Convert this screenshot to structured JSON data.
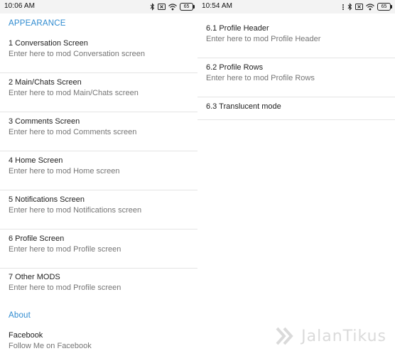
{
  "left": {
    "status": {
      "time": "10:06 AM",
      "battery": "65"
    },
    "appearance_header": "APPEARANCE",
    "items": [
      {
        "title": "1 Conversation Screen",
        "subtitle": "Enter here to mod Conversation screen"
      },
      {
        "title": "2 Main/Chats Screen",
        "subtitle": "Enter here to mod Main/Chats screen"
      },
      {
        "title": "3 Comments Screen",
        "subtitle": "Enter here to mod Comments screen"
      },
      {
        "title": "4 Home Screen",
        "subtitle": "Enter here to mod Home screen"
      },
      {
        "title": "5 Notifications Screen",
        "subtitle": "Enter here to mod Notifications screen"
      },
      {
        "title": "6 Profile Screen",
        "subtitle": "Enter here to mod Profile screen"
      },
      {
        "title": "7 Other MODS",
        "subtitle": "Enter here to mod Profile screen"
      }
    ],
    "about_header": "About",
    "about_items": [
      {
        "title": "Facebook",
        "subtitle": "Follow Me on Facebook"
      }
    ]
  },
  "right": {
    "status": {
      "time": "10:54 AM",
      "battery": "65"
    },
    "items": [
      {
        "title": "6.1 Profile Header",
        "subtitle": "Enter here to mod Profile Header"
      },
      {
        "title": "6.2 Profile Rows",
        "subtitle": "Enter here to mod Profile Rows"
      },
      {
        "title": "6.3 Translucent mode"
      }
    ]
  },
  "watermark": {
    "text": "JalanTikus",
    "icon": "jalantikus-logo-icon"
  },
  "colors": {
    "accent": "#2f8bd0",
    "statusbar": "#f3f3f3",
    "divider": "#e4e4e4",
    "subtitle": "#757575"
  }
}
